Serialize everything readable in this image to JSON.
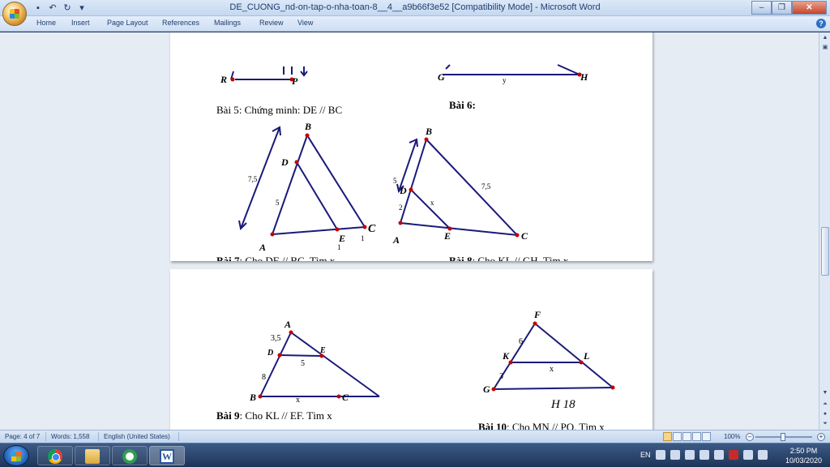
{
  "window": {
    "title": "DE_CUONG_nd-on-tap-o-nha-toan-8__4__a9b66f3e52 [Compatibility Mode] - Microsoft Word",
    "minimize_icon": "minimize-icon",
    "maximize_icon": "restore-icon",
    "close_icon": "close-icon"
  },
  "ribbon": {
    "tabs": [
      "Home",
      "Insert",
      "Page Layout",
      "References",
      "Mailings",
      "Review",
      "View"
    ]
  },
  "page1": {
    "fig5": {
      "labels": [
        "R",
        "P"
      ]
    },
    "fig6": {
      "labels": [
        "G",
        "y",
        "H"
      ]
    },
    "bai5": {
      "head": "Bài 5",
      "rest": ": Chứng minh: DE // BC"
    },
    "bai6": {
      "head": "Bài 6:"
    },
    "fig7": {
      "B": "B",
      "D": "D",
      "A": "A",
      "E": "E",
      "C": "C",
      "n1": "7,5",
      "n2": "5",
      "n3": "1",
      "n4": "1"
    },
    "fig8": {
      "B": "B",
      "D": "D",
      "A": "A",
      "E": "E",
      "C": "C",
      "n1": "5",
      "n2": "2",
      "n3": "x",
      "n4": "7,5"
    },
    "bai7": {
      "head": "Bài 7",
      "rest": ": Cho DE // BC. Tìm x"
    },
    "bai8": {
      "head": "Bài 8",
      "rest": ": Cho KL // GH. Tìm x"
    }
  },
  "page2": {
    "fig9": {
      "A": "A",
      "D": "D",
      "E": "E",
      "B": "B",
      "C": "C",
      "n1": "3,5",
      "n2": "5",
      "n3": "8",
      "n4": "x"
    },
    "fig10": {
      "F": "F",
      "K": "K",
      "L": "L",
      "G": "G",
      "n1": "6",
      "n2": "x",
      "n3": "3",
      "caption": "H 18"
    },
    "bai9": {
      "head": "Bài 9",
      "rest": ": Cho KL // EF. Tìm x"
    },
    "bai10": {
      "head": "Bài 10",
      "rest": ": Cho MN // PQ. Tìm x"
    }
  },
  "statusbar": {
    "page": "Page: 4 of 7",
    "words": "Words: 1,558",
    "language": "English (United States)",
    "zoom": "100%",
    "zoom_level": 1.0
  },
  "taskbar": {
    "apps": [
      "chrome-icon",
      "folder-icon",
      "coccoc-icon",
      "word-icon"
    ],
    "lang": "EN",
    "time": "2:50 PM",
    "date": "10/03/2020"
  }
}
